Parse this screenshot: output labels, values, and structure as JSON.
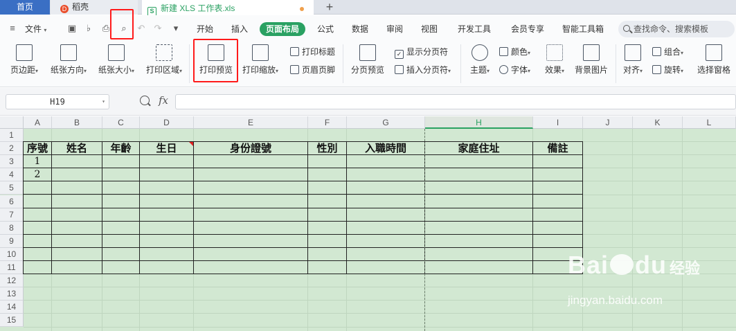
{
  "tabs": {
    "home": "首页",
    "daoke": "稻壳",
    "file": "新建 XLS 工作表.xls",
    "new_tab": "+"
  },
  "menubar": {
    "file_menu": "文件",
    "tabs": [
      "开始",
      "插入",
      "页面布局",
      "公式",
      "数据",
      "审阅",
      "视图",
      "开发工具",
      "会员专享",
      "智能工具箱"
    ],
    "active_tab": "页面布局",
    "search_placeholder": "查找命令、搜索模板"
  },
  "ribbon": {
    "page_margin": "页边距",
    "paper_orientation": "纸张方向",
    "paper_size": "纸张大小",
    "print_area": "打印区域",
    "print_preview": "打印预览",
    "print_scale": "打印缩放",
    "print_titles": "打印标题",
    "header_footer": "页眉页脚",
    "page_break_preview": "分页预览",
    "show_page_breaks": "显示分页符",
    "insert_page_break": "插入分页符",
    "theme": "主题",
    "colors": "颜色",
    "fonts": "字体",
    "effects": "效果",
    "background_image": "背景图片",
    "align": "对齐",
    "group": "组合",
    "rotate": "旋转",
    "selection_pane": "选择窗格"
  },
  "formula_bar": {
    "name_box": "H19",
    "fx": "fx",
    "formula": ""
  },
  "sheet": {
    "columns": [
      "A",
      "B",
      "C",
      "D",
      "E",
      "F",
      "G",
      "H",
      "I",
      "J",
      "K",
      "L"
    ],
    "selected_column": "H",
    "rows": [
      "1",
      "2",
      "3",
      "4",
      "5",
      "6",
      "7",
      "8",
      "9",
      "10",
      "11",
      "12",
      "13",
      "14",
      "15"
    ],
    "headers": [
      "序號",
      "姓名",
      "年齡",
      "生日",
      "身份證號",
      "性別",
      "入職時間",
      "家庭住址",
      "備註"
    ],
    "serials": [
      "1",
      "2"
    ]
  },
  "watermark": {
    "main": "Bai",
    "main2": "du",
    "cn": "经验",
    "sub": "jingyan.baidu.com"
  },
  "colors": {
    "accent_green": "#2aa162",
    "grid_bg": "#d2e8d2",
    "highlight_red": "#ff1a1a"
  }
}
